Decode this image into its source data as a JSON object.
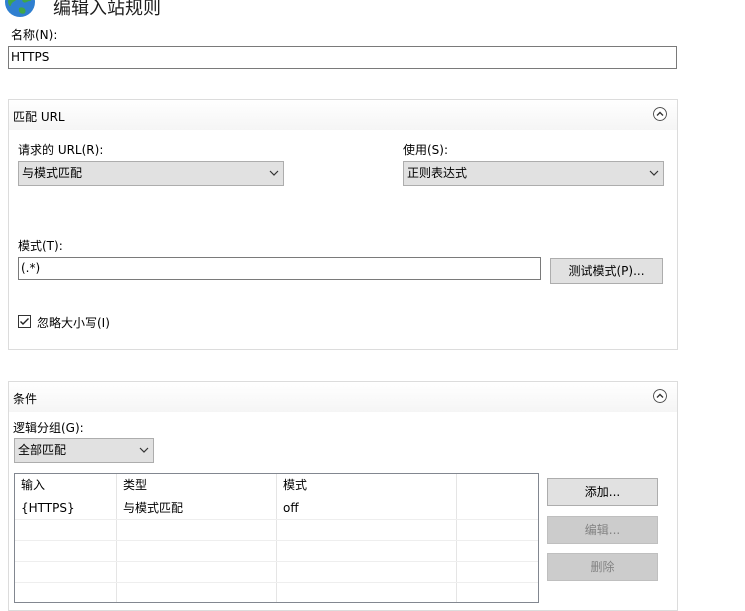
{
  "header": {
    "title": "编辑入站规则",
    "icon": "globe-icon"
  },
  "name_field": {
    "label": "名称(N):",
    "value": "HTTPS"
  },
  "match_url": {
    "section_title": "匹配 URL",
    "requested_url_label": "请求的 URL(R):",
    "requested_url_value": "与模式匹配",
    "using_label": "使用(S):",
    "using_value": "正则表达式",
    "pattern_label": "模式(T):",
    "pattern_value": "(.*)",
    "test_pattern_button": "测试模式(P)...",
    "ignore_case_label": "忽略大小写(I)",
    "ignore_case_checked": true
  },
  "conditions": {
    "section_title": "条件",
    "logical_grouping_label": "逻辑分组(G):",
    "logical_grouping_value": "全部匹配",
    "columns": [
      "输入",
      "类型",
      "模式"
    ],
    "rows": [
      [
        "{HTTPS}",
        "与模式匹配",
        "off"
      ]
    ],
    "add_button": "添加...",
    "edit_button": "编辑...",
    "delete_button": "删除"
  },
  "colors": {
    "panel_border": "#dcdcdc",
    "button_bg": "#e1e1e1",
    "disabled_text": "#838383"
  }
}
